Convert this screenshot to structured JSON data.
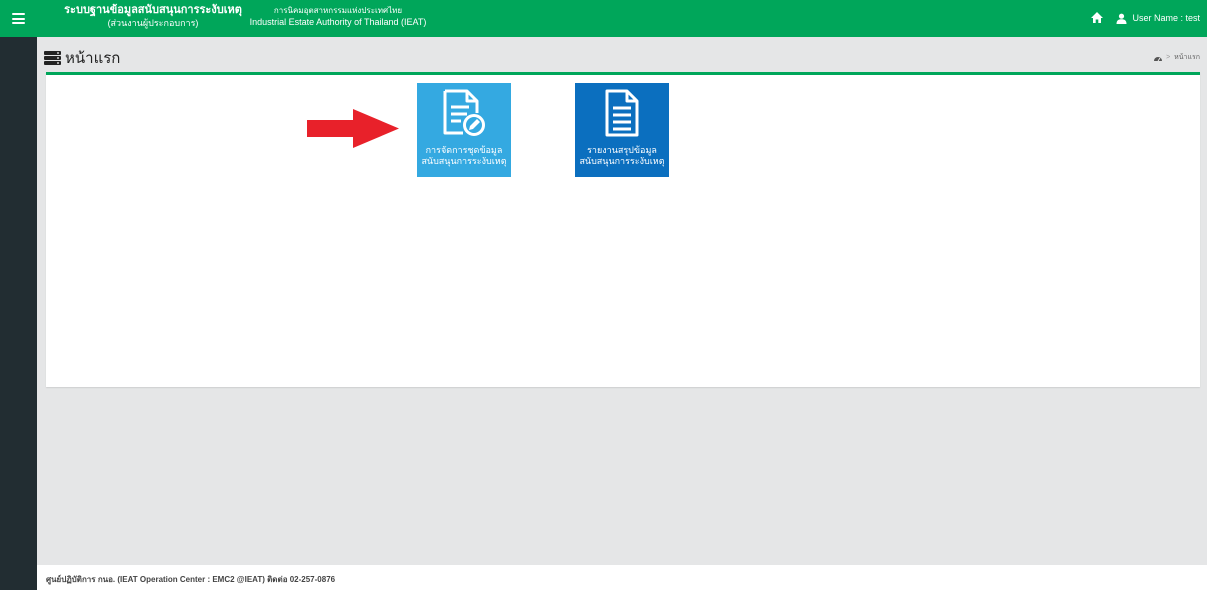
{
  "header": {
    "brand_line1": "ระบบฐานข้อมูลสนับสนุนการระงับเหตุ",
    "brand_line2": "(ส่วนงานผู้ประกอบการ)",
    "org_line1": "การนิคมอุตสาหกรรมแห่งประเทศไทย",
    "org_line2": "Industrial Estate Authority of Thailand (IEAT)",
    "user_label": "User Name : test",
    "accent_color": "#00a65a"
  },
  "page": {
    "title": "หน้าแรก"
  },
  "breadcrumb": {
    "current": "หน้าแรก",
    "separator": ">"
  },
  "tiles": [
    {
      "line1": "การจัดการชุดข้อมูล",
      "line2": "สนับสนุนการระงับเหตุ",
      "icon": "edit-document-icon",
      "color": "#34a9e1"
    },
    {
      "line1": "รายงานสรุปข้อมูล",
      "line2": "สนับสนุนการระงับเหตุ",
      "icon": "document-icon",
      "color": "#0b6fbf"
    }
  ],
  "footer": {
    "text": "ศูนย์ปฏิบัติการ กนอ. (IEAT Operation Center : EMC2 @IEAT) ติดต่อ 02-257-0876"
  }
}
